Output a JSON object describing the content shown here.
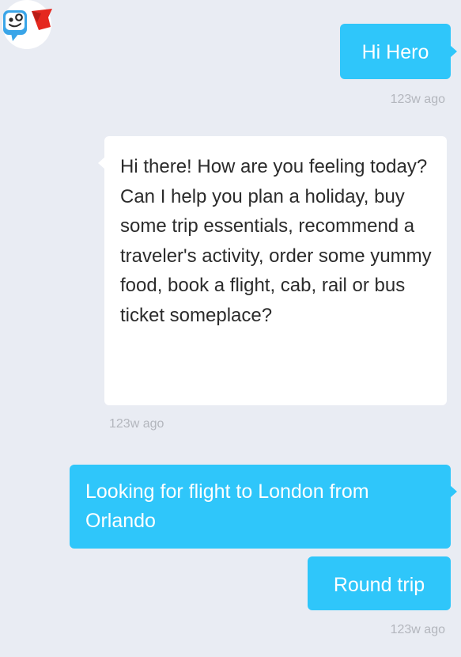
{
  "messages": [
    {
      "sender": "user",
      "text": "Hi Hero",
      "time": "123w ago"
    },
    {
      "sender": "bot",
      "text": "Hi there! How are you feeling today? Can I help you plan a holiday, buy some trip essentials, recommend a traveler's activity, order some yummy food, book a flight, cab, rail or bus ticket someplace?",
      "time": "123w ago"
    },
    {
      "sender": "user",
      "text": "Looking for flight to London from Orlando"
    },
    {
      "sender": "user",
      "text": "Round trip",
      "time": "123w ago"
    }
  ],
  "colors": {
    "background": "#e9ecf3",
    "user_bubble": "#2fc6fa",
    "bot_bubble": "#ffffff",
    "avatar_blue": "#3aa5e8",
    "avatar_cape": "#e5281f",
    "timestamp": "#b3b6bd"
  },
  "icons": {
    "avatar": "hero-bot-avatar-icon"
  }
}
